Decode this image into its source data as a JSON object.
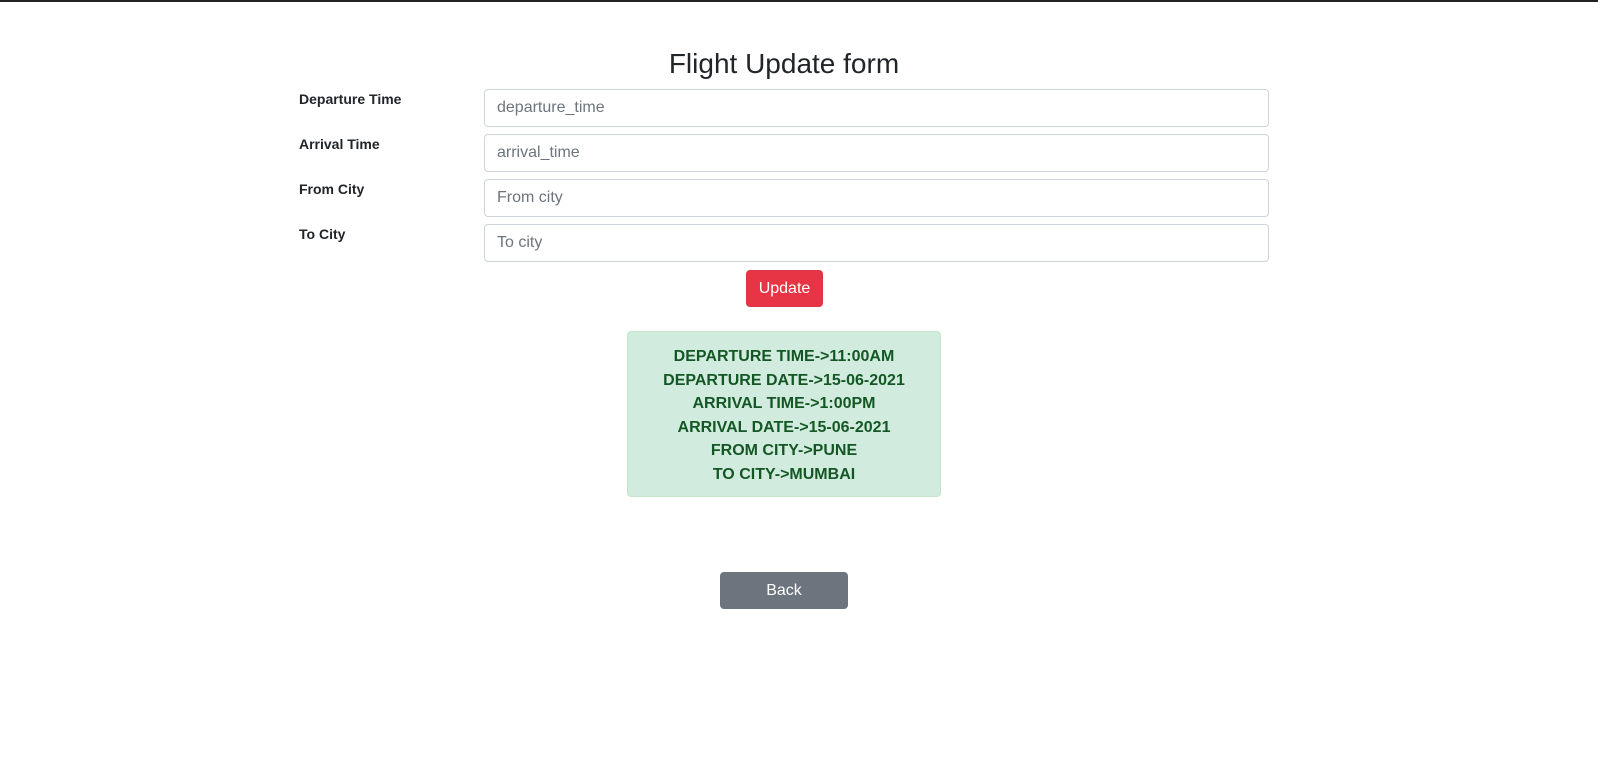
{
  "header": {
    "title": "Flight Update form"
  },
  "form": {
    "fields": [
      {
        "label": "Departure Time",
        "placeholder": "departure_time",
        "value": ""
      },
      {
        "label": "Arrival Time",
        "placeholder": "arrival_time",
        "value": ""
      },
      {
        "label": "From City",
        "placeholder": "From city",
        "value": ""
      },
      {
        "label": "To City",
        "placeholder": "To city",
        "value": ""
      }
    ],
    "update_label": "Update"
  },
  "flight_info": {
    "lines": [
      "DEPARTURE TIME->11:00AM",
      "DEPARTURE DATE->15-06-2021",
      "ARRIVAL TIME->1:00PM",
      "ARRIVAL DATE->15-06-2021",
      "FROM CITY->PUNE",
      "TO CITY->MUMBAI"
    ]
  },
  "footer": {
    "back_label": "Back"
  },
  "colors": {
    "update_button": "#e83545",
    "back_button": "#6c757d",
    "info_background": "#d1ecdf",
    "info_text": "#155724"
  }
}
